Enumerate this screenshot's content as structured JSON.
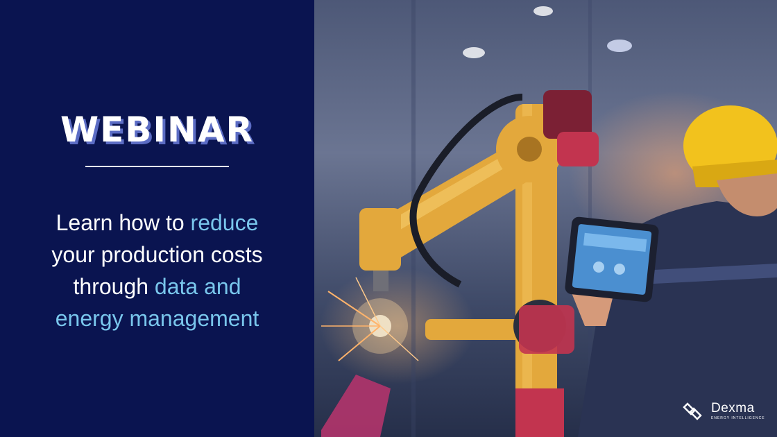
{
  "banner": {
    "title": "WEBINAR",
    "tagline": [
      [
        {
          "text": "Learn how to ",
          "highlight": false
        },
        {
          "text": "reduce",
          "highlight": true
        }
      ],
      [
        {
          "text": "your production costs",
          "highlight": false
        }
      ],
      [
        {
          "text": "through ",
          "highlight": false
        },
        {
          "text": "data and",
          "highlight": true
        }
      ],
      [
        {
          "text": "energy management",
          "highlight": true
        }
      ]
    ]
  },
  "brand": {
    "name": "Dexma",
    "tagline": "ENERGY INTELLIGENCE"
  },
  "colors": {
    "panel": "#0a1450",
    "highlight": "#79c6ec",
    "title_shadow": "#5b6cc4"
  },
  "photo": {
    "subject": "industrial robot arm and engineer with tablet"
  }
}
